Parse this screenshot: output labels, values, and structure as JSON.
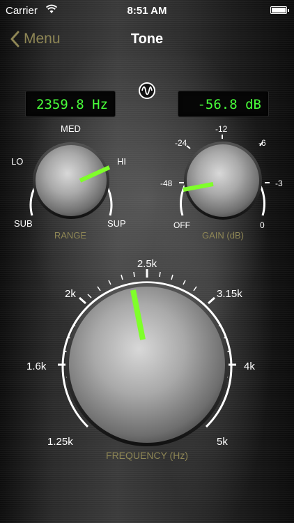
{
  "status_bar": {
    "carrier": "Carrier",
    "time": "8:51 AM"
  },
  "nav": {
    "back_label": "Menu",
    "title": "Tone"
  },
  "icons": {
    "back": "chevron-left-icon",
    "wifi": "wifi-icon",
    "battery": "battery-icon",
    "waveform": "sine-wave-icon"
  },
  "colors": {
    "accent": "#8e8655",
    "lcd_text": "#49ff3a",
    "indicator": "#7fff2a"
  },
  "displays": {
    "frequency": "2359.8 Hz",
    "gain": "-56.8 dB"
  },
  "range_knob": {
    "caption": "RANGE",
    "labels": {
      "sub": "SUB",
      "lo": "LO",
      "med": "MED",
      "hi": "HI",
      "sup": "SUP"
    }
  },
  "gain_knob": {
    "caption": "GAIN (dB)",
    "labels": {
      "off": "OFF",
      "m48": "-48",
      "m24": "-24",
      "m12": "-12",
      "m6": "-6",
      "m3": "-3",
      "zero": "0"
    }
  },
  "frequency_knob": {
    "caption": "FREQUENCY (Hz)",
    "labels": {
      "f125": "1.25k",
      "f16": "1.6k",
      "f2": "2k",
      "f25": "2.5k",
      "f315": "3.15k",
      "f4": "4k",
      "f5": "5k"
    }
  }
}
